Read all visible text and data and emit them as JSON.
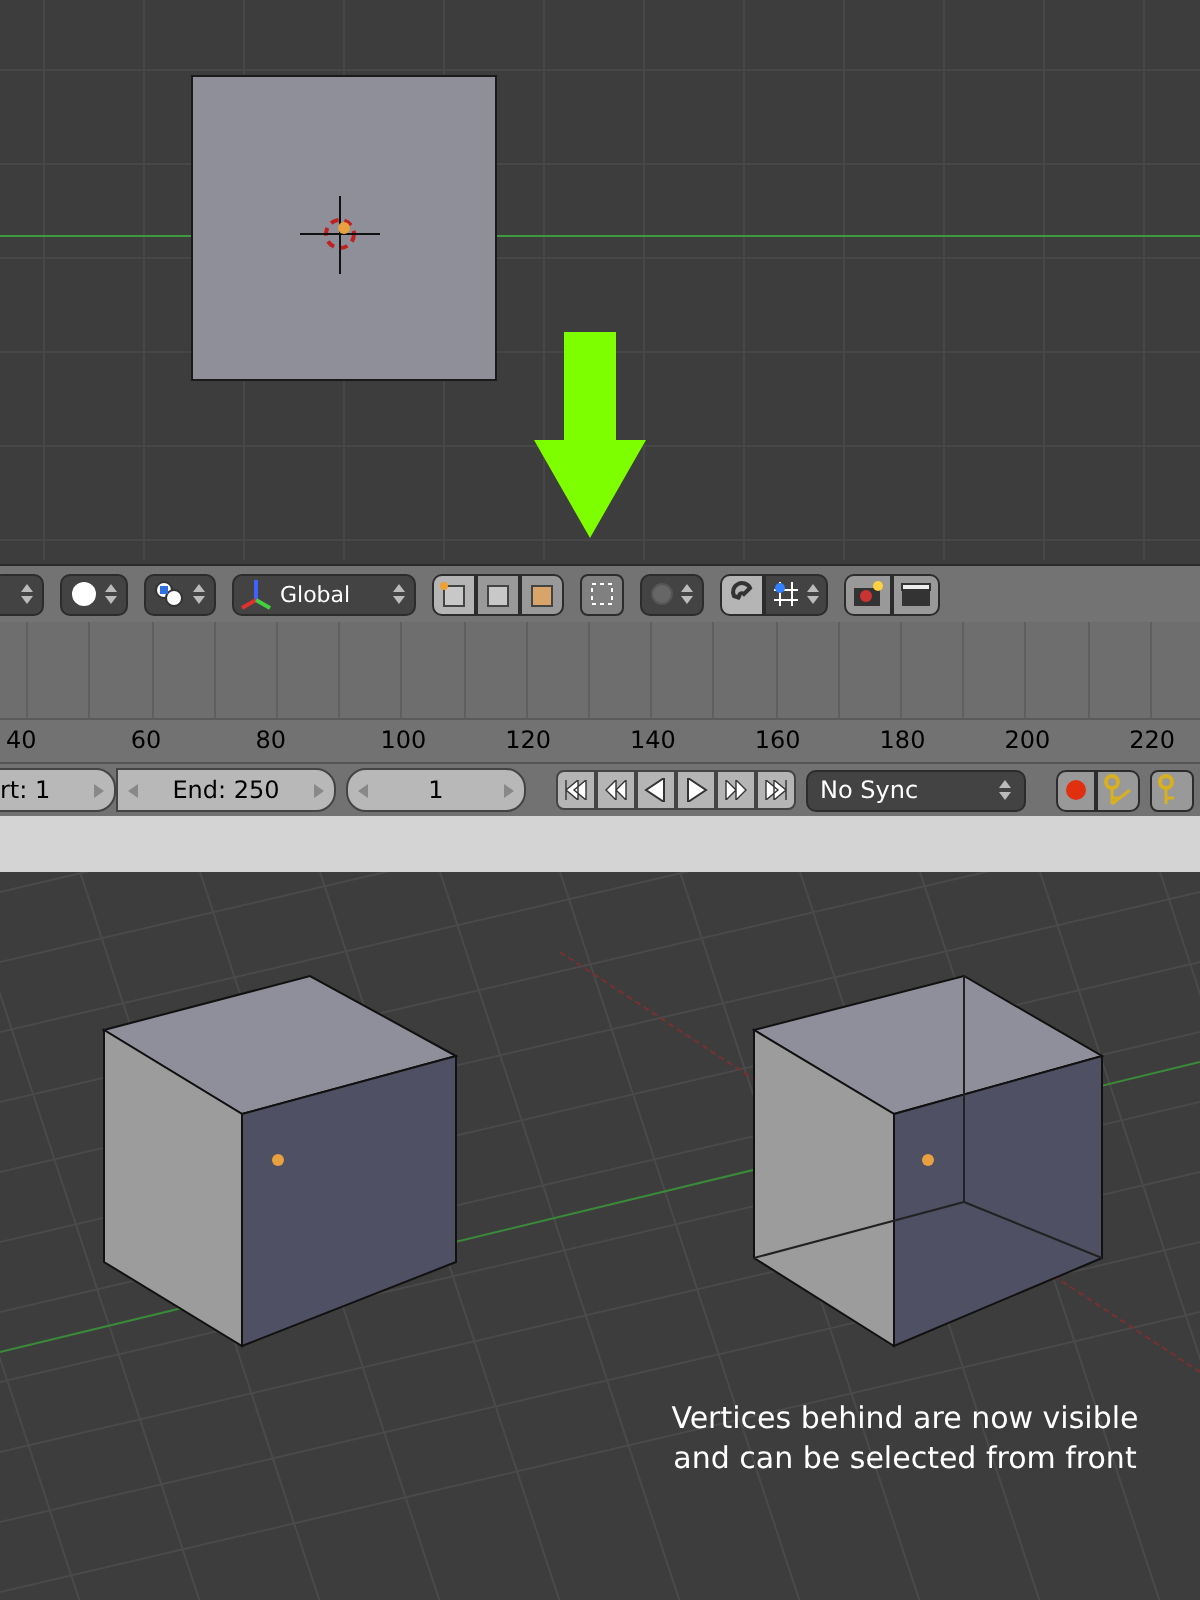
{
  "header": {
    "orientation": {
      "label": "Global"
    },
    "select_modes": [
      {
        "kind": "vertex",
        "selected": true
      },
      {
        "kind": "edge",
        "selected": false
      },
      {
        "kind": "face",
        "selected": false
      }
    ],
    "limit_to_visible": {
      "on": false
    },
    "snap": {
      "on": true
    }
  },
  "timeline": {
    "ruler": [
      "40",
      "60",
      "80",
      "100",
      "120",
      "140",
      "160",
      "180",
      "200",
      "220"
    ]
  },
  "playback": {
    "start": "rt: 1",
    "end": "End: 250",
    "current": "1",
    "sync": "No Sync"
  },
  "caption": "Vertices behind are now visible and can be selected from front"
}
